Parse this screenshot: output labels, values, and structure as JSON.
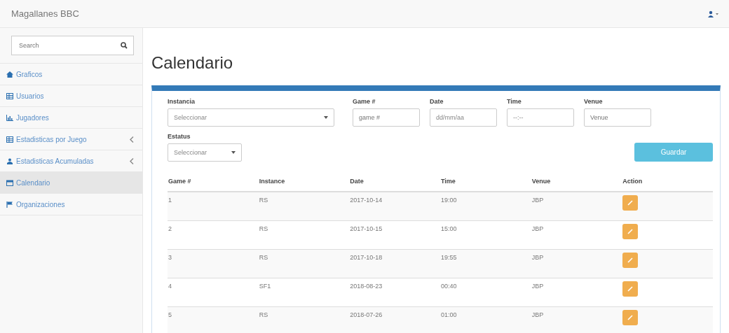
{
  "navbar": {
    "brand": "Magallanes BBC"
  },
  "sidebar": {
    "search": {
      "placeholder": "Search"
    },
    "items": [
      {
        "label": "Graficos",
        "selected": false,
        "has_submenu": false
      },
      {
        "label": "Usuarios",
        "selected": false,
        "has_submenu": false
      },
      {
        "label": "Jugadores",
        "selected": false,
        "has_submenu": false
      },
      {
        "label": "Estadisticas por Juego",
        "selected": false,
        "has_submenu": true
      },
      {
        "label": "Estadisticas Acumuladas",
        "selected": false,
        "has_submenu": true
      },
      {
        "label": "Calendario",
        "selected": true,
        "has_submenu": false
      },
      {
        "label": "Organizaciones",
        "selected": false,
        "has_submenu": false
      }
    ]
  },
  "page_title": "Calendario",
  "form": {
    "fields": [
      {
        "label": "Instancia",
        "kind": "select",
        "value": "Seleccionar"
      },
      {
        "label": "Game #",
        "kind": "input",
        "placeholder": "game #"
      },
      {
        "label": "Date",
        "kind": "input",
        "value": "dd/mm/aa"
      },
      {
        "label": "Time",
        "kind": "input",
        "value": "--:--"
      },
      {
        "label": "Venue",
        "kind": "input",
        "placeholder": "Venue"
      }
    ],
    "status": {
      "label": "Estatus",
      "value": "Seleccionar"
    },
    "save_button": "Guardar"
  },
  "table": {
    "columns": [
      "Game #",
      "Instance",
      "Date",
      "Time",
      "Venue",
      "Action"
    ],
    "rows": [
      [
        "1",
        "RS",
        "2017-10-14",
        "19:00",
        "JBP"
      ],
      [
        "2",
        "RS",
        "2017-10-15",
        "15:00",
        "JBP"
      ],
      [
        "3",
        "RS",
        "2017-10-18",
        "19:55",
        "JBP"
      ],
      [
        "4",
        "SF1",
        "2018-08-23",
        "00:40",
        "JBP"
      ],
      [
        "5",
        "RS",
        "2018-07-26",
        "01:00",
        "JBP"
      ]
    ]
  }
}
